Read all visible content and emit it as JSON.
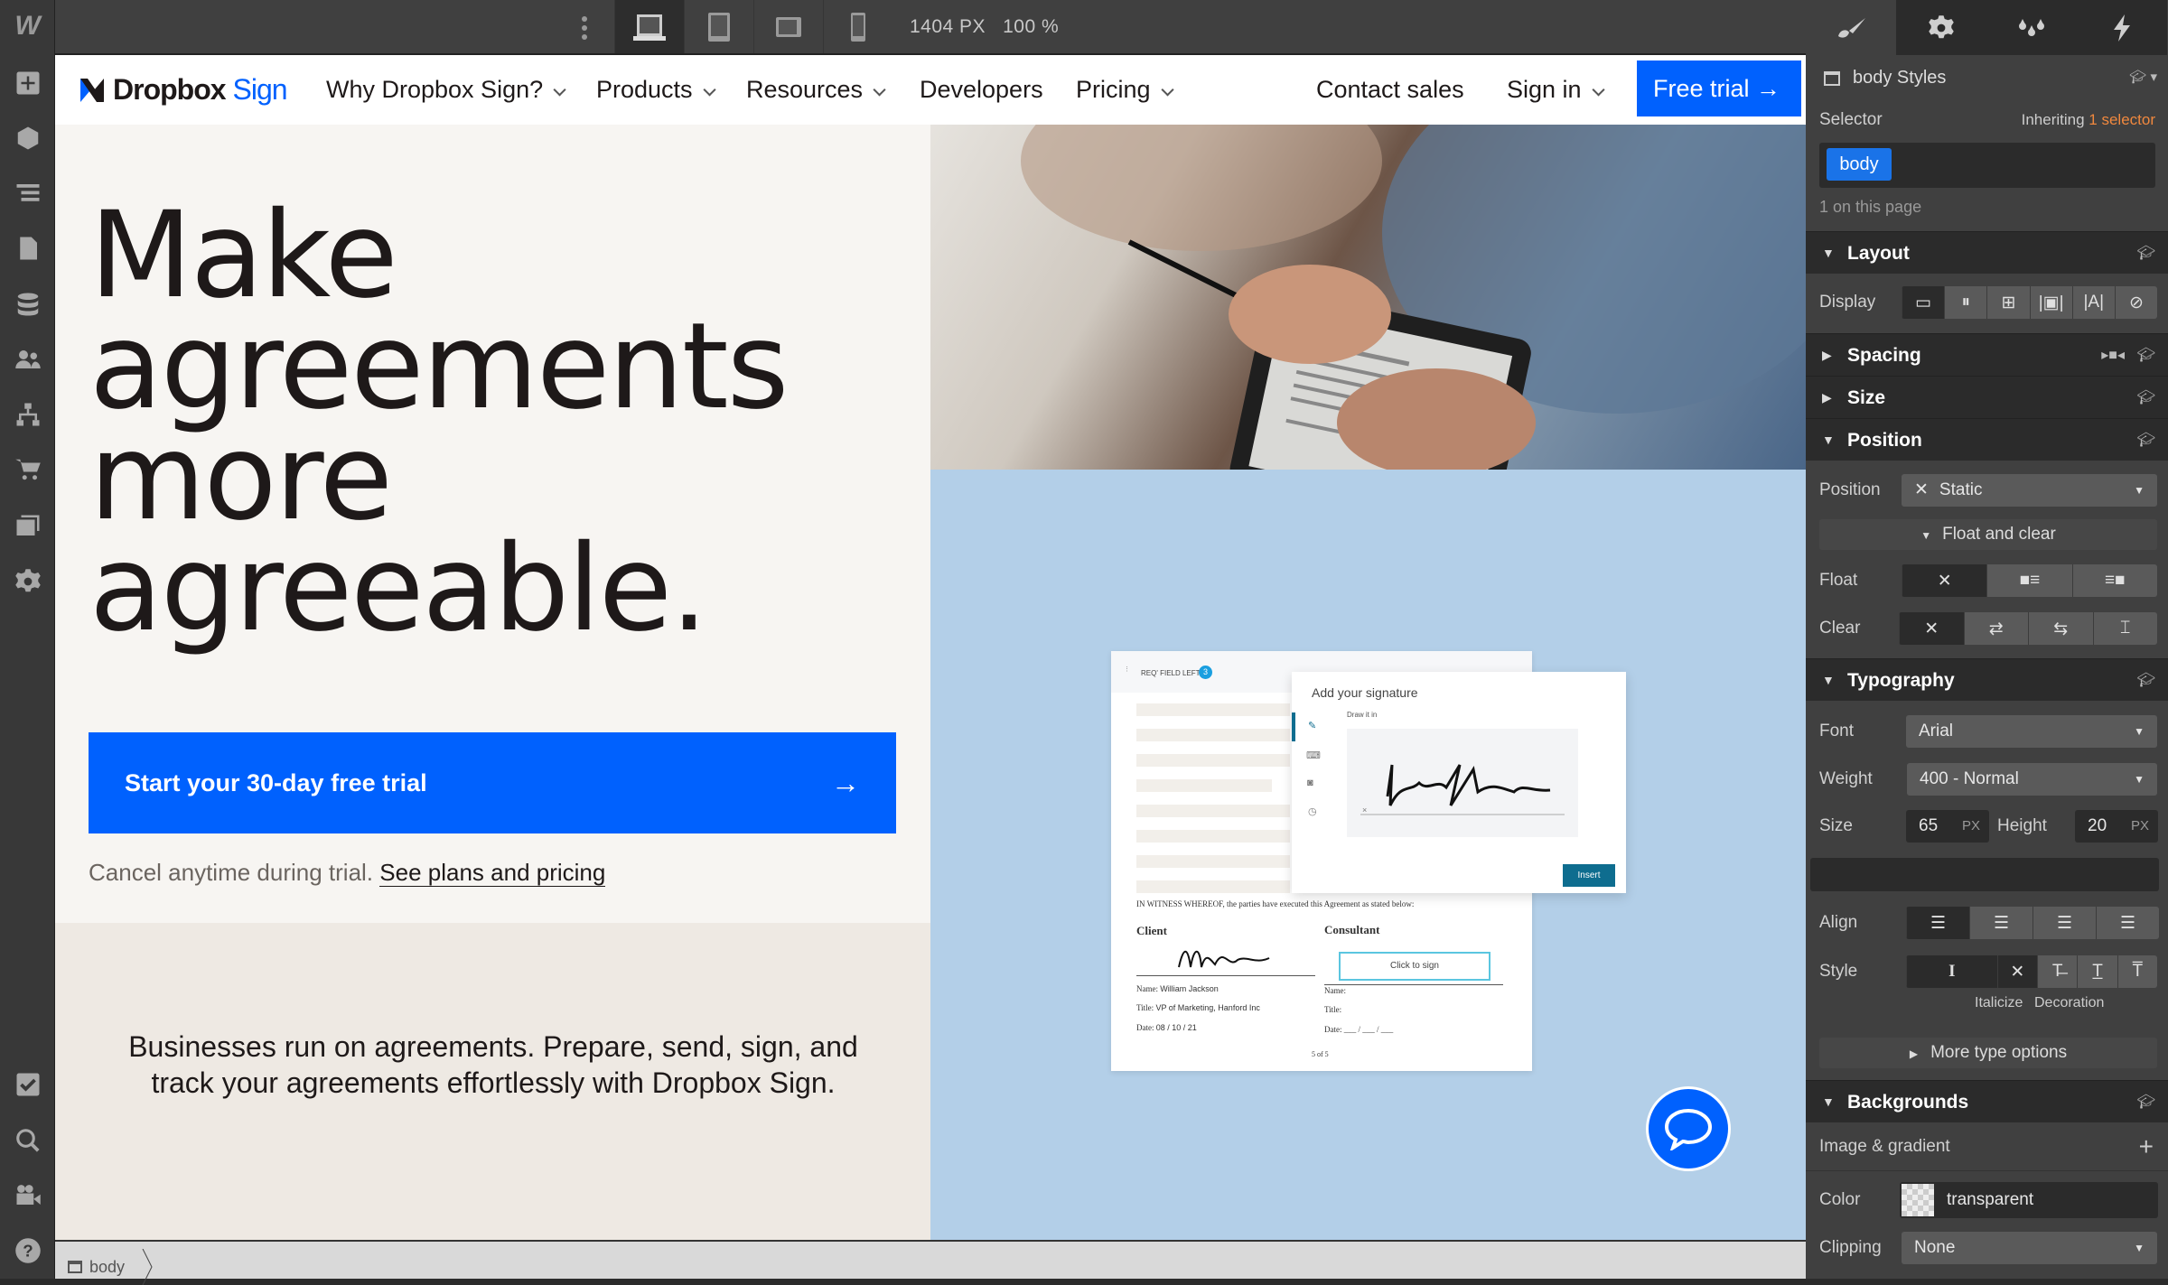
{
  "topbar": {
    "viewport_width": "1404 PX",
    "zoom": "100 %"
  },
  "leftbar": {
    "logo": "W"
  },
  "site": {
    "logo_primary": "Dropbox",
    "logo_secondary": "Sign",
    "nav": [
      {
        "label": "Why Dropbox Sign?"
      },
      {
        "label": "Products"
      },
      {
        "label": "Resources"
      },
      {
        "label": "Developers"
      },
      {
        "label": "Pricing"
      }
    ],
    "contact": "Contact sales",
    "signin": "Sign in",
    "free_trial": "Free trial →",
    "headline": [
      "Make",
      "agreements",
      "more",
      "agreeable."
    ],
    "cta": "Start your 30-day free trial",
    "cta_arrow": "→",
    "cancel_text": "Cancel anytime during trial.",
    "cancel_link": "See plans and pricing",
    "paragraph": "Businesses run on agreements. Prepare, send, sign, and track your agreements effortlessly with Dropbox Sign.",
    "doc": {
      "req_field": "REQ' FIELD LEFT",
      "req_count": "3",
      "modal_title": "Add your signature",
      "draw_label": "Draw it in",
      "insert": "Insert",
      "witness": "IN WITNESS WHEREOF, the parties have executed this Agreement as stated below:",
      "client": "Client",
      "consultant": "Consultant",
      "click_to_sign": "Click to sign",
      "name_label": "Name:",
      "name_value": "William Jackson",
      "title_label": "Title:",
      "title_value": "VP of Marketing, Hanford Inc",
      "date_label": "Date:",
      "date_value": "08 / 10 / 21",
      "date_blank": "___ / ___ / ___",
      "page": "5 of 5"
    }
  },
  "breadcrumb": {
    "item": "body"
  },
  "panel": {
    "header": "body Styles",
    "selector_label": "Selector",
    "inheriting": "Inheriting",
    "inheriting_count": "1 selector",
    "selector_chip": "body",
    "on_page": "1 on this page",
    "layout": "Layout",
    "display_label": "Display",
    "spacing": "Spacing",
    "size": "Size",
    "position_sec": "Position",
    "position_label": "Position",
    "position_value": "Static",
    "float_clear": "Float and clear",
    "float_label": "Float",
    "clear_label": "Clear",
    "typography": "Typography",
    "font_label": "Font",
    "font_value": "Arial",
    "weight_label": "Weight",
    "weight_value": "400 - Normal",
    "size_label": "Size",
    "size_value": "65",
    "size_unit": "PX",
    "height_label": "Height",
    "height_value": "20",
    "height_unit": "PX",
    "align_label": "Align",
    "style_label": "Style",
    "italicize": "Italicize",
    "decoration": "Decoration",
    "more_type": "More type options",
    "backgrounds": "Backgrounds",
    "image_gradient": "Image &  gradient",
    "color_label": "Color",
    "color_value": "transparent",
    "clipping_label": "Clipping",
    "clipping_value": "None",
    "accent": "#1a73e8",
    "orange": "#f0883e"
  }
}
